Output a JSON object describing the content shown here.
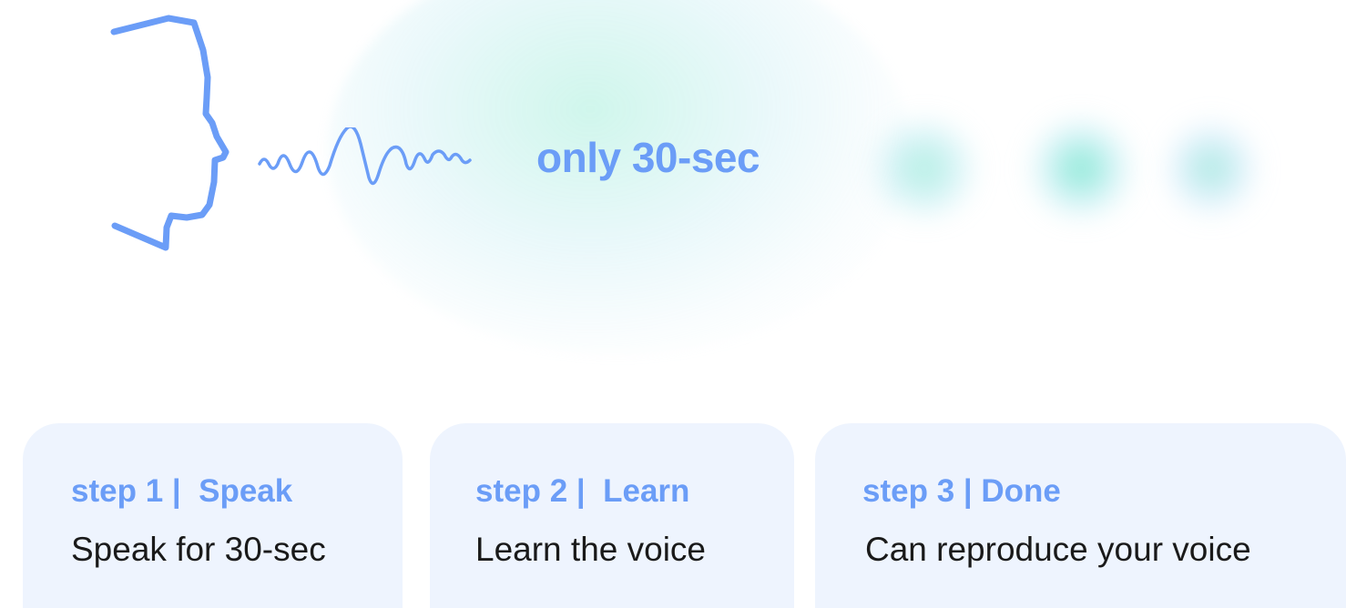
{
  "headline": "only 30-sec",
  "colors": {
    "accent": "#6b9df7",
    "card_bg": "#eef4fe",
    "text": "#1a1a1a",
    "glow": "#7de6c8"
  },
  "illustration": {
    "face": "face-profile-icon",
    "wave": "sound-wave-icon"
  },
  "steps": [
    {
      "title": "step 1 |  Speak",
      "description": "Speak for 30-sec"
    },
    {
      "title": "step 2 |  Learn",
      "description": "Learn the voice"
    },
    {
      "title": "step 3 | Done",
      "description": "Can reproduce your voice"
    }
  ]
}
